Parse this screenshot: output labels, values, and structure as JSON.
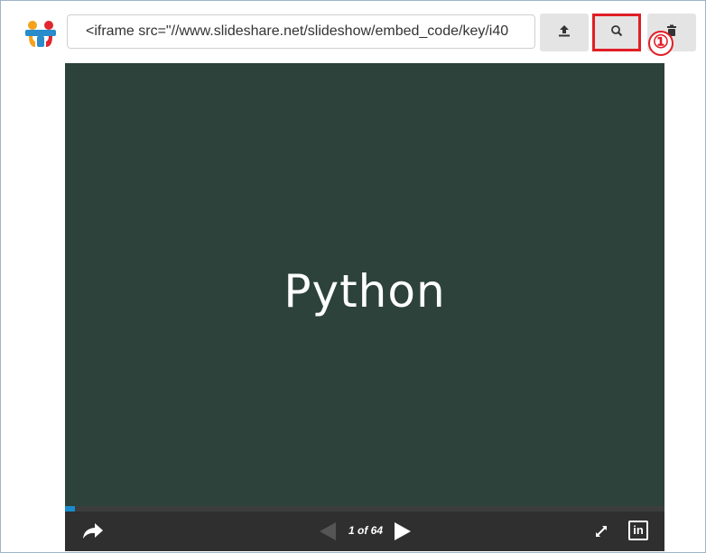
{
  "toolbar": {
    "embed_code_value": "<iframe src=\"//www.slideshare.net/slideshow/embed_code/key/i40",
    "upload_icon": "upload-icon",
    "search_icon": "search-icon",
    "delete_icon": "trash-icon",
    "annotation_marker": "①",
    "annotation_color": "#e01e26"
  },
  "logo": {
    "icon": "slideshare-logo",
    "colors": [
      "#f6a21d",
      "#2a8ccb",
      "#e2262e"
    ]
  },
  "player": {
    "slide_title": "Python",
    "background_color": "#2c423b",
    "progress": 0.016,
    "progress_color": "#1a8ccc",
    "page_counter": "1 of 64",
    "share_icon": "share-arrow-icon",
    "prev_icon": "prev-triangle-icon",
    "next_icon": "next-triangle-icon",
    "fullscreen_icon": "expand-icon",
    "linkedin_label": "in"
  }
}
